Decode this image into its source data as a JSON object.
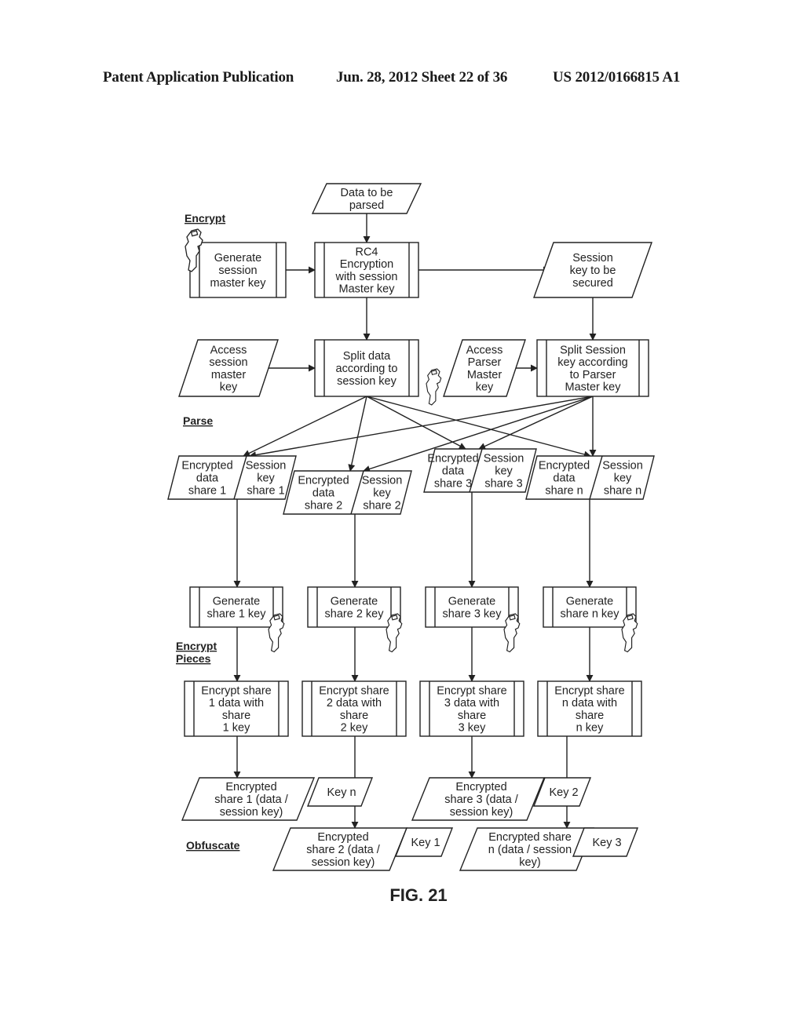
{
  "header": {
    "left": "Patent Application Publication",
    "middle": "Jun. 28, 2012  Sheet 22 of 36",
    "right": "US 2012/0166815 A1"
  },
  "figure_label": "FIG. 21",
  "sections": [
    {
      "id": "encrypt",
      "label": "Encrypt"
    },
    {
      "id": "parse",
      "label": "Parse"
    },
    {
      "id": "encrypt-pieces",
      "label": "Encrypt\nPieces"
    },
    {
      "id": "obfuscate",
      "label": "Obfuscate"
    }
  ],
  "nodes": [
    {
      "id": "data-to-be-parsed",
      "type": "io",
      "text": "Data to be\nparsed"
    },
    {
      "id": "generate-session-master-key",
      "type": "process",
      "text": "Generate\nsession\nmaster key",
      "key_icon": true
    },
    {
      "id": "rc4-encryption",
      "type": "process",
      "text": "RC4\nEncryption\nwith session\nMaster key"
    },
    {
      "id": "session-key-to-be-secured",
      "type": "io",
      "text": "Session\nkey to be\nsecured"
    },
    {
      "id": "access-session-master-key",
      "type": "io",
      "text": "Access\nsession\nmaster\nkey"
    },
    {
      "id": "split-data",
      "type": "process",
      "text": "Split data\naccording to\nsession key"
    },
    {
      "id": "access-parser-master-key",
      "type": "io",
      "text": "Access\nParser\nMaster\nkey",
      "key_icon": true
    },
    {
      "id": "split-session-key",
      "type": "process",
      "text": "Split Session\nkey according\nto Parser\nMaster key"
    },
    {
      "id": "share-1",
      "type": "split-io",
      "left": "Encrypted\ndata\nshare 1",
      "right": "Session\nkey\nshare 1"
    },
    {
      "id": "share-2",
      "type": "split-io",
      "left": "Encrypted\ndata\nshare 2",
      "right": "Session\nkey\nshare 2"
    },
    {
      "id": "share-3",
      "type": "split-io",
      "left": "Encrypted\ndata\nshare 3",
      "right": "Session\nkey\nshare 3"
    },
    {
      "id": "share-n",
      "type": "split-io",
      "left": "Encrypted\ndata\nshare n",
      "right": "Session\nkey\nshare n"
    },
    {
      "id": "gen-share-1-key",
      "type": "process",
      "text": "Generate\nshare 1 key",
      "key_icon": true
    },
    {
      "id": "gen-share-2-key",
      "type": "process",
      "text": "Generate\nshare 2 key",
      "key_icon": true
    },
    {
      "id": "gen-share-3-key",
      "type": "process",
      "text": "Generate\nshare 3 key",
      "key_icon": true
    },
    {
      "id": "gen-share-n-key",
      "type": "process",
      "text": "Generate\nshare n key",
      "key_icon": true
    },
    {
      "id": "enc-share-1",
      "type": "process",
      "text": "Encrypt share\n1 data with\nshare\n1 key"
    },
    {
      "id": "enc-share-2",
      "type": "process",
      "text": "Encrypt share\n2 data with\nshare\n2 key"
    },
    {
      "id": "enc-share-3",
      "type": "process",
      "text": "Encrypt share\n3 data with\nshare\n3 key"
    },
    {
      "id": "enc-share-n",
      "type": "process",
      "text": "Encrypt share\nn data with\nshare\nn key"
    },
    {
      "id": "out-share-1",
      "type": "io-with-key",
      "text": "Encrypted\nshare 1 (data /\nsession key)",
      "key": "Key n"
    },
    {
      "id": "out-share-2",
      "type": "io-with-key",
      "text": "Encrypted\nshare 2 (data /\nsession key)",
      "key": "Key 1"
    },
    {
      "id": "out-share-3",
      "type": "io-with-key",
      "text": "Encrypted\nshare 3 (data /\nsession key)",
      "key": "Key 2"
    },
    {
      "id": "out-share-n",
      "type": "io-with-key",
      "text": "Encrypted share\nn (data / session\nkey)",
      "key": "Key 3"
    }
  ],
  "edges": [
    [
      "data-to-be-parsed",
      "rc4-encryption"
    ],
    [
      "generate-session-master-key",
      "rc4-encryption"
    ],
    [
      "rc4-encryption",
      "session-key-to-be-secured"
    ],
    [
      "rc4-encryption",
      "split-data"
    ],
    [
      "session-key-to-be-secured",
      "split-session-key"
    ],
    [
      "access-session-master-key",
      "split-data"
    ],
    [
      "access-parser-master-key",
      "split-session-key"
    ],
    [
      "split-data",
      "share-1.data"
    ],
    [
      "split-data",
      "share-2.data"
    ],
    [
      "split-data",
      "share-3.data"
    ],
    [
      "split-data",
      "share-n.data"
    ],
    [
      "split-session-key",
      "share-1.key"
    ],
    [
      "split-session-key",
      "share-2.key"
    ],
    [
      "split-session-key",
      "share-3.key"
    ],
    [
      "split-session-key",
      "share-n.key"
    ],
    [
      "share-1",
      "gen-share-1-key"
    ],
    [
      "share-2",
      "gen-share-2-key"
    ],
    [
      "share-3",
      "gen-share-3-key"
    ],
    [
      "share-n",
      "gen-share-n-key"
    ],
    [
      "gen-share-1-key",
      "enc-share-1"
    ],
    [
      "gen-share-2-key",
      "enc-share-2"
    ],
    [
      "gen-share-3-key",
      "enc-share-3"
    ],
    [
      "gen-share-n-key",
      "enc-share-n"
    ],
    [
      "enc-share-1",
      "out-share-1"
    ],
    [
      "enc-share-2",
      "out-share-2"
    ],
    [
      "enc-share-3",
      "out-share-3"
    ],
    [
      "enc-share-n",
      "out-share-n"
    ]
  ]
}
